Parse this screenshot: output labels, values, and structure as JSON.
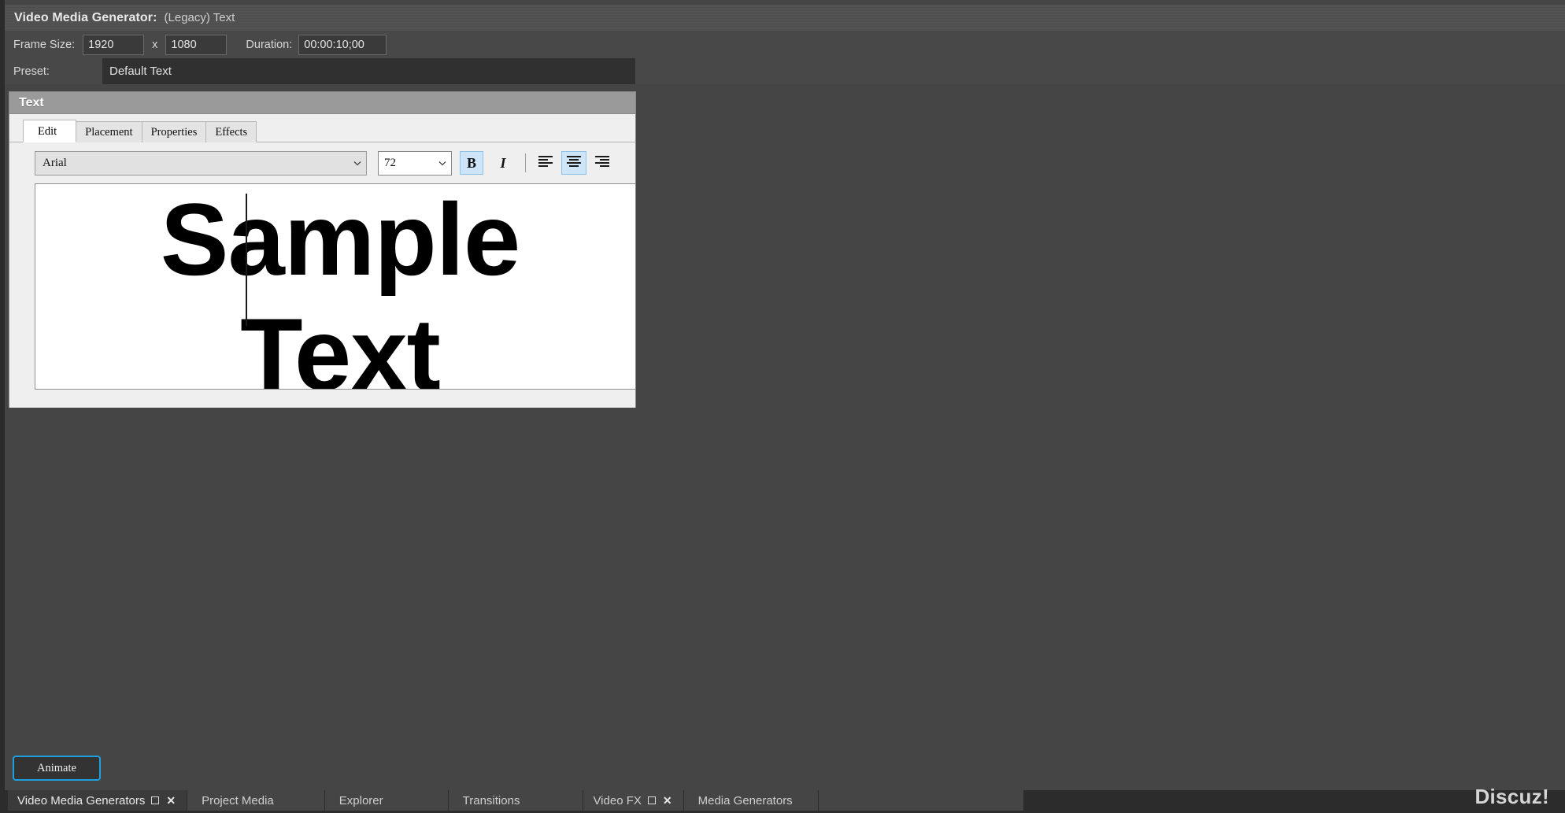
{
  "generator": {
    "title_label": "Video Media Generator:",
    "title_value": "(Legacy) Text",
    "frame_size_label": "Frame Size:",
    "frame_width": "1920",
    "frame_size_x": "x",
    "frame_height": "1080",
    "duration_label": "Duration:",
    "duration_value": "00:00:10;00",
    "preset_label": "Preset:",
    "preset_value": "Default Text"
  },
  "panel": {
    "caption": "Text",
    "tabs": [
      {
        "label": "Edit",
        "active": true
      },
      {
        "label": "Placement",
        "active": false
      },
      {
        "label": "Properties",
        "active": false
      },
      {
        "label": "Effects",
        "active": false
      }
    ],
    "toolbar": {
      "font_family_value": "Arial",
      "font_size_value": "72",
      "bold_label": "B",
      "bold_active": true,
      "italic_label": "I",
      "italic_active": false,
      "align_left_active": false,
      "align_center_active": true,
      "align_right_active": false
    },
    "canvas": {
      "sample_text": "Sample\nText"
    }
  },
  "animate": {
    "label": "Animate"
  },
  "taskbar": {
    "tabs": [
      {
        "label": "Video Media Generators",
        "active": true,
        "has_restore": true,
        "has_close": true
      },
      {
        "label": "Project Media",
        "active": false,
        "has_restore": false,
        "has_close": false
      },
      {
        "label": "Explorer",
        "active": false,
        "has_restore": false,
        "has_close": false
      },
      {
        "label": "Transitions",
        "active": false,
        "has_restore": false,
        "has_close": false
      },
      {
        "label": "Video FX",
        "active": false,
        "has_restore": true,
        "has_close": true
      },
      {
        "label": "Media Generators",
        "active": false,
        "has_restore": false,
        "has_close": false
      }
    ]
  },
  "watermark": {
    "text": "Discuz!"
  },
  "colors": {
    "window_bg": "#454545",
    "header_bg": "#4e4e4e",
    "panel_bg": "#efefef",
    "panel_caption_bg": "#9a9a9a",
    "accent_blue": "#1e9fe0",
    "toggle_selected": "#cde5f7",
    "taskbar_bg": "#2c2c2c"
  }
}
